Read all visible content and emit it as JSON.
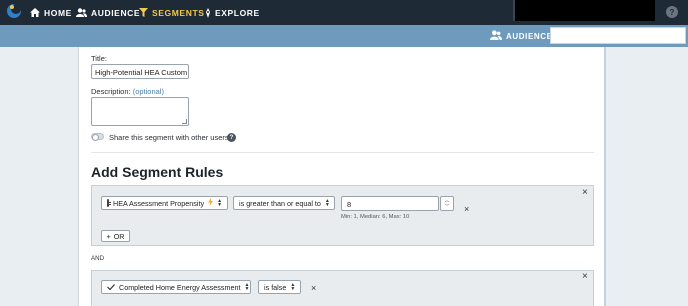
{
  "nav": {
    "items": [
      {
        "label": "HOME",
        "icon": "home-icon"
      },
      {
        "label": "AUDIENCE",
        "icon": "audience-icon"
      },
      {
        "label": "SEGMENTS",
        "icon": "filter-icon",
        "active": true
      },
      {
        "label": "EXPLORE",
        "icon": "explore-icon"
      }
    ],
    "help": "?"
  },
  "subbar": {
    "audience_label": "AUDIENCE:",
    "audience_value": ""
  },
  "form": {
    "title_label": "Title:",
    "title_value": "High-Potential HEA Custom",
    "description_label": "Description:",
    "description_optional": "(optional)",
    "description_value": "",
    "share_label": "Share this segment with other users",
    "share_enabled": false,
    "help": "?"
  },
  "rules": {
    "heading": "Add Segment Rules",
    "rule1": {
      "field": "HEA Assessment Propensity",
      "operator": "is greater than or equal to",
      "value": "8",
      "hint": "Min: 1, Median: 6, Max: 10",
      "remove": "×",
      "close": "×",
      "or_button": "OR"
    },
    "and_label": "AND",
    "rule2": {
      "field": "Completed Home Energy Assessment",
      "operator": "is false",
      "remove": "×",
      "close": "×"
    }
  },
  "colors": {
    "nav_bg": "#1f2a37",
    "active_nav": "#f2c94c",
    "subbar_bg": "#6e9bbd",
    "page_bg": "#e9eef2",
    "rule_bg": "#e9ecef"
  }
}
